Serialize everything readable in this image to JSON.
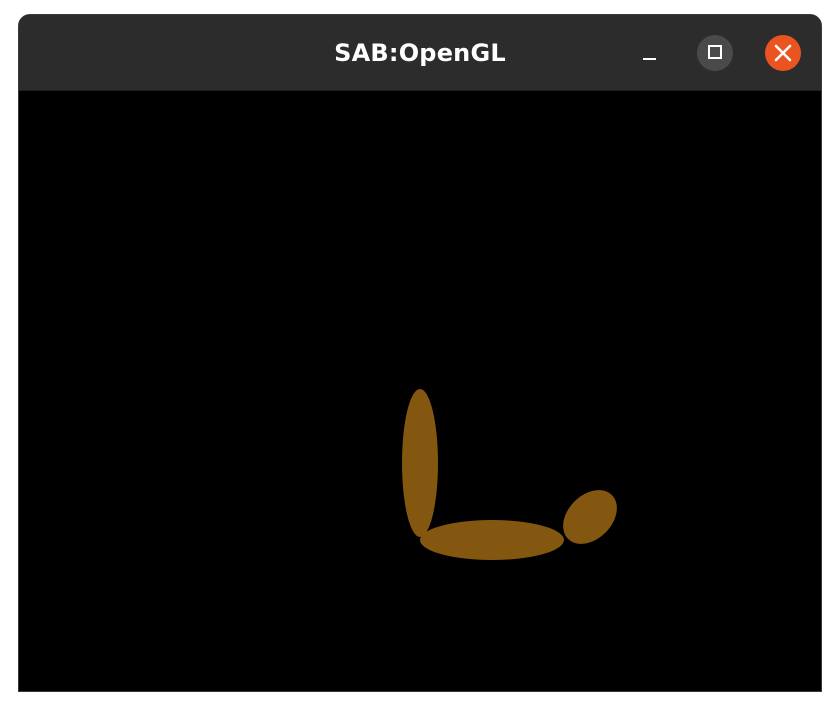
{
  "window": {
    "title": "SAB:OpenGL"
  },
  "controls": {
    "minimize_icon": "minimize-icon",
    "maximize_icon": "maximize-icon",
    "close_icon": "close-icon",
    "close_color": "#e95420"
  },
  "scene": {
    "background": "#000000",
    "shape_color": "#83570f",
    "shapes": [
      "upper-vertical-segment",
      "horizontal-segment",
      "end-segment"
    ]
  }
}
